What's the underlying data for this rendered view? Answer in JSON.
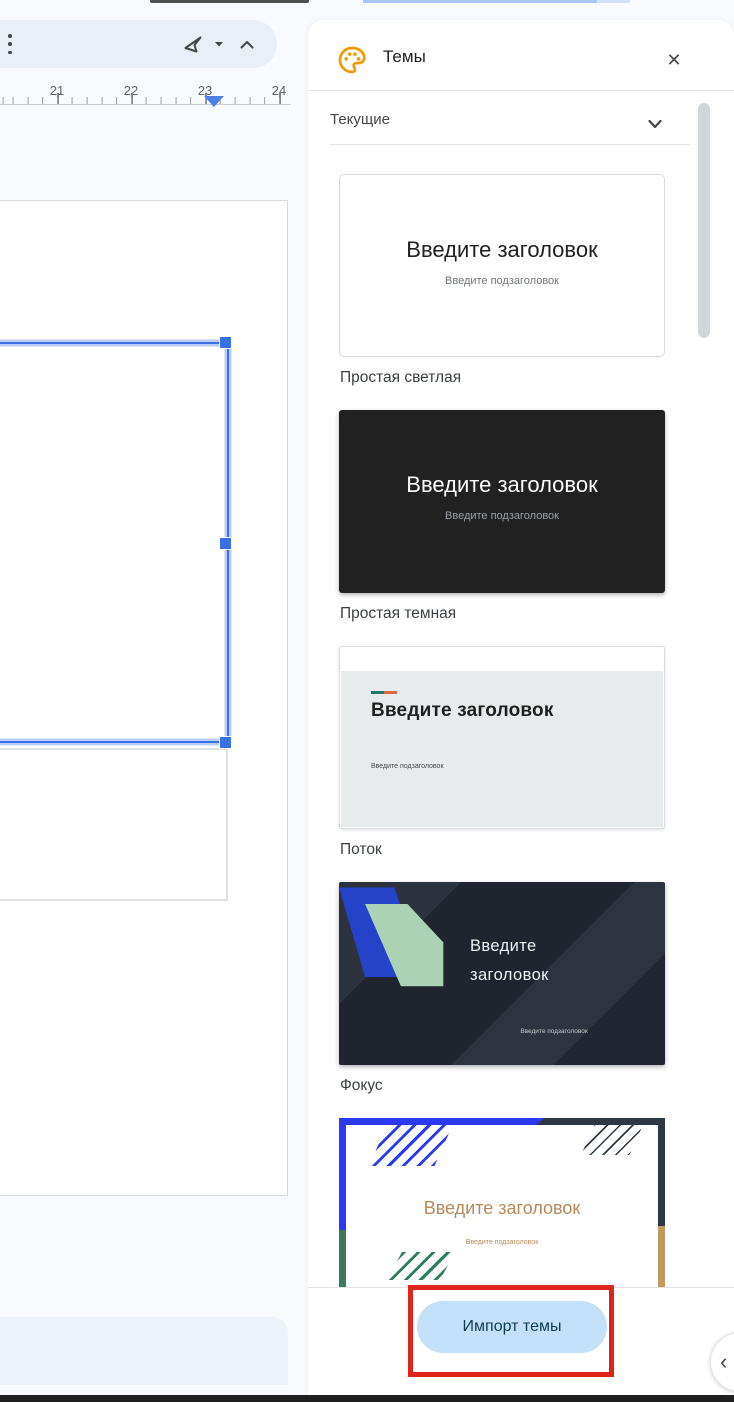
{
  "colors": {
    "accent_blue": "#3a6fe8",
    "annotation_red": "#df241c",
    "import_button_bg": "#c3e2f9",
    "palette_icon": "#f29900",
    "panel_bg": "#ffffff",
    "workspace_bg": "#f8fafd"
  },
  "ruler": {
    "numbers": [
      "21",
      "22",
      "23",
      "24"
    ]
  },
  "panel": {
    "title": "Темы",
    "close_icon": "✕",
    "section_label": "Текущие",
    "themes": [
      {
        "label": "Простая светлая",
        "slide_title": "Введите заголовок",
        "slide_subtitle": "Введите подзаголовок"
      },
      {
        "label": "Простая темная",
        "slide_title": "Введите заголовок",
        "slide_subtitle": "Введите подзаголовок"
      },
      {
        "label": "Поток",
        "slide_title": "Введите заголовок",
        "slide_subtitle": "Введите подзаголовок"
      },
      {
        "label": "Фокус",
        "slide_title_line1": "Введите",
        "slide_title_line2": "заголовок",
        "slide_subtitle": "Введите подзаголовок"
      },
      {
        "slide_title": "Введите заголовок",
        "slide_subtitle": "Введите подзаголовок"
      }
    ],
    "import_button": "Импорт темы",
    "collapse_chevron": "‹"
  }
}
